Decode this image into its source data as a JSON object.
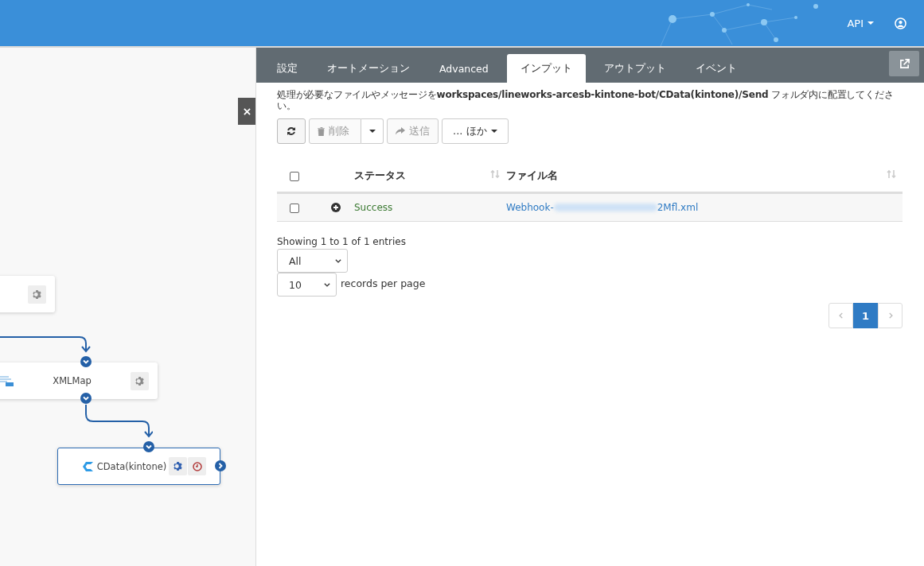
{
  "header": {
    "menu_label": "API"
  },
  "canvas": {
    "nodes": [
      {
        "kind": "partial"
      },
      {
        "kind": "xmlmap",
        "label": "XMLMap"
      },
      {
        "kind": "cdata",
        "label": "CData(kintone)"
      }
    ]
  },
  "tabs": [
    {
      "label": "設定",
      "selected": false
    },
    {
      "label": "オートメーション",
      "selected": false
    },
    {
      "label": "Advanced",
      "selected": false
    },
    {
      "label": "インプット",
      "selected": true
    },
    {
      "label": "アウトプット",
      "selected": false
    },
    {
      "label": "イベント",
      "selected": false
    }
  ],
  "instruction": "処理が必要なファイルやメッセージを**workspaces/lineworks-arcesb-kintone-bot/CData(kintone)/Send** フォルダ内に配置してください。",
  "toolbar": [
    {
      "kind": "refresh",
      "disabled": false
    },
    {
      "kind": "delete",
      "label": "削除",
      "disabled": true
    },
    {
      "kind": "send",
      "label": "送信",
      "disabled": true
    },
    {
      "kind": "more",
      "label": "... ほか",
      "disabled": false
    }
  ],
  "table": {
    "select_all": {
      "checked": false
    },
    "columns": [
      "ステータス",
      "ファイル名"
    ],
    "rows": [
      {
        "checked": false,
        "expanded": false,
        "status": "Success",
        "file_name_start": "Webhook-",
        "file_name_end": "2Mfl.xml"
      }
    ]
  },
  "info": "Showing 1 to 1 of 1 entries",
  "filter_select": "All",
  "page_size_select": "10",
  "page_size_label": "records per page",
  "pagination": {
    "prev_disabled": true,
    "next_disabled": true,
    "pages": [
      {
        "label": "1",
        "selected": true
      }
    ]
  }
}
